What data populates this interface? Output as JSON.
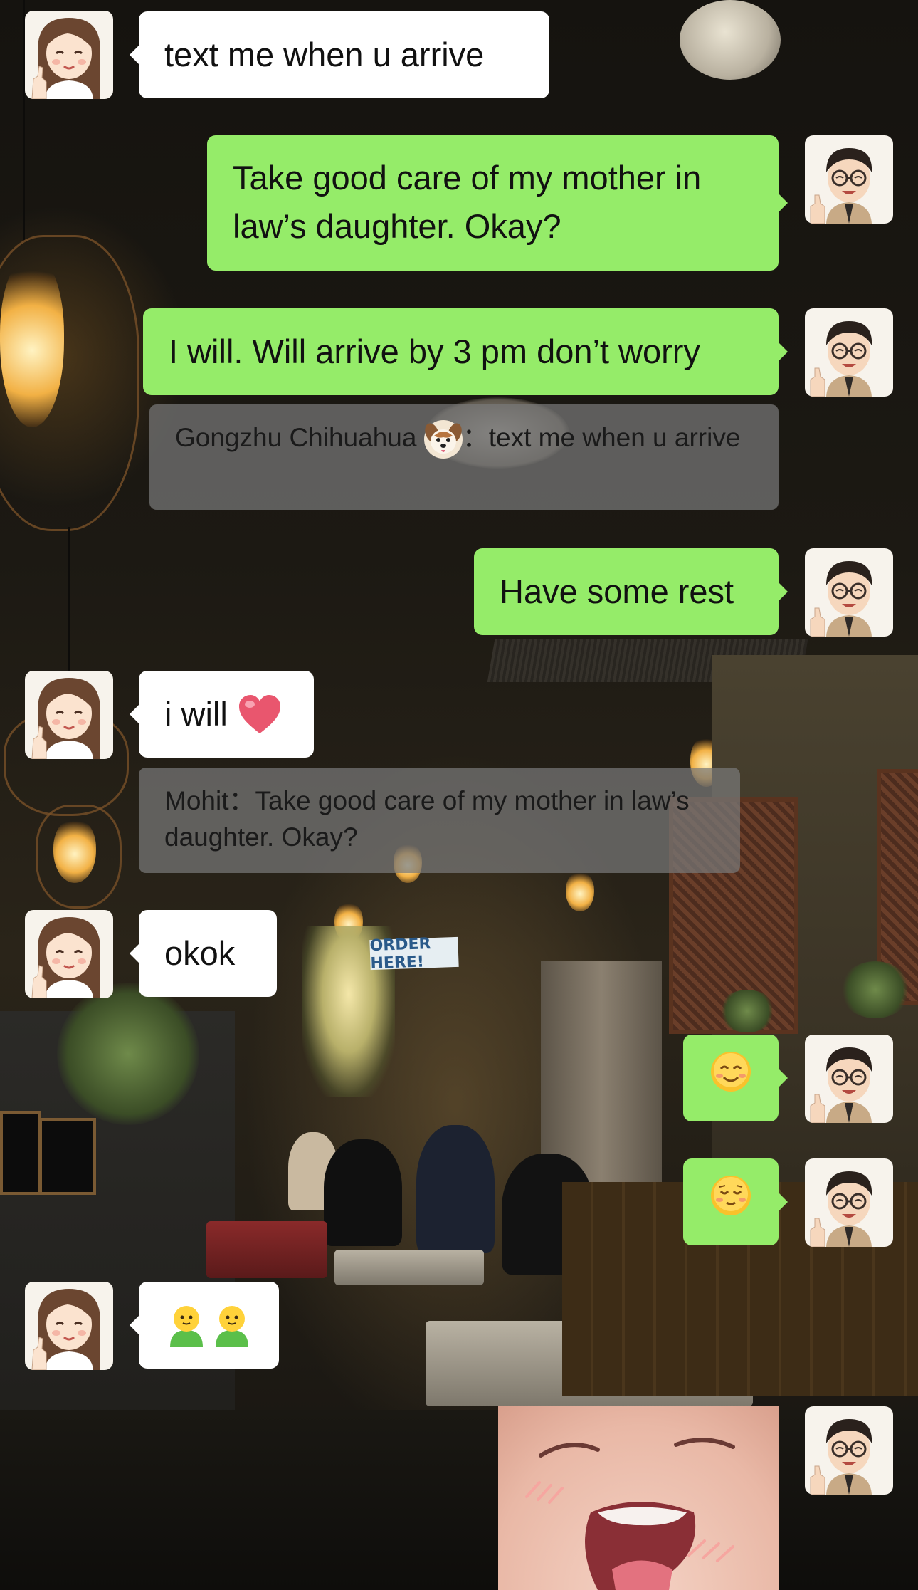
{
  "chat": {
    "messages": [
      {
        "sender": "Gongzhu Chihuahua",
        "direction": "incoming",
        "text": "text me when u arrive"
      },
      {
        "sender": "Mohit",
        "direction": "outgoing",
        "text": "Take good care of my mother in law’s daughter. Okay?"
      },
      {
        "sender": "Mohit",
        "direction": "outgoing",
        "text": "I will. Will arrive by 3 pm don’t worry",
        "quote": {
          "author": "Gongzhu Chihuahua",
          "emoji": "dog-face-icon",
          "separator": "：",
          "text": "text me when u arrive"
        }
      },
      {
        "sender": "Mohit",
        "direction": "outgoing",
        "text": "Have some rest"
      },
      {
        "sender": "Gongzhu Chihuahua",
        "direction": "incoming",
        "text": "i will",
        "emoji": "red-heart-icon",
        "quote": {
          "author": "Mohit",
          "separator": "：",
          "text": "Take good care of my mother in law’s daughter. Okay?"
        }
      },
      {
        "sender": "Gongzhu Chihuahua",
        "direction": "incoming",
        "text": "okok"
      },
      {
        "sender": "Mohit",
        "direction": "outgoing",
        "emoji": "smiling-face-icon"
      },
      {
        "sender": "Mohit",
        "direction": "outgoing",
        "emoji": "relieved-face-icon"
      },
      {
        "sender": "Gongzhu Chihuahua",
        "direction": "incoming",
        "emoji": "two-buddies-icon"
      },
      {
        "sender": "Mohit",
        "direction": "outgoing",
        "image": "laughing-baby-photo"
      }
    ]
  },
  "background": {
    "sign_text": "ORDER HERE!"
  },
  "colors": {
    "outgoing_bubble": "#95ec69",
    "incoming_bubble": "#ffffff",
    "quote_bg": "#7a7a7a"
  }
}
